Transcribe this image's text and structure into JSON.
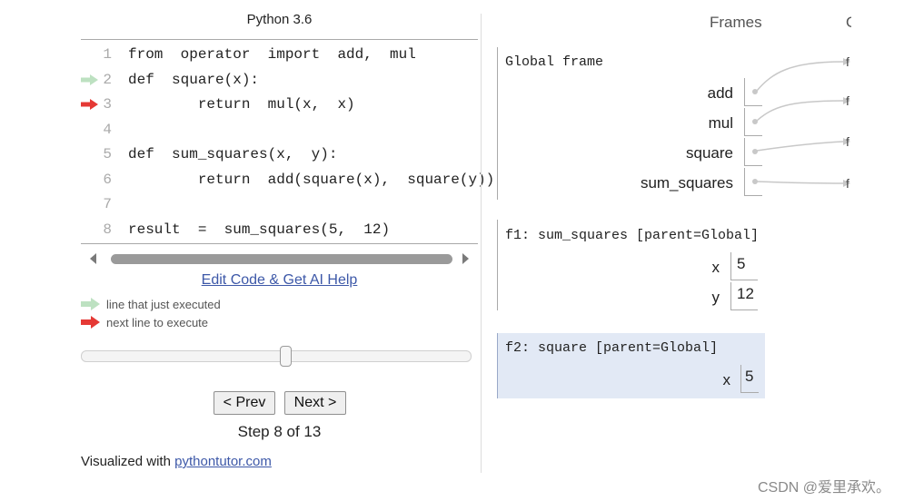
{
  "left_panel": {
    "language_title": "Python 3.6",
    "code_lines": [
      {
        "num": "1",
        "text": "from  operator  import  add,  mul",
        "arrow": ""
      },
      {
        "num": "2",
        "text": "def  square(x):",
        "arrow": "green"
      },
      {
        "num": "3",
        "text": "        return  mul(x,  x)",
        "arrow": "red"
      },
      {
        "num": "4",
        "text": "",
        "arrow": ""
      },
      {
        "num": "5",
        "text": "def  sum_squares(x,  y):",
        "arrow": ""
      },
      {
        "num": "6",
        "text": "        return  add(square(x),  square(y))",
        "arrow": ""
      },
      {
        "num": "7",
        "text": "",
        "arrow": ""
      },
      {
        "num": "8",
        "text": "result  =  sum_squares(5,  12)",
        "arrow": ""
      }
    ],
    "edit_link": "Edit Code & Get AI Help",
    "legend": [
      {
        "color": "green",
        "text": "line that just executed"
      },
      {
        "color": "red",
        "text": "next line to execute"
      }
    ],
    "slider": {
      "step": 8,
      "total": 13
    },
    "prev_label": "< Prev",
    "next_label": "Next >",
    "step_text": "Step 8 of 13",
    "footer_prefix": "Visualized with ",
    "footer_link": "pythontutor.com"
  },
  "right_panel": {
    "frames_title": "Frames",
    "objects_title": "Objects",
    "global_frame": {
      "title": "Global frame",
      "variables": [
        "add",
        "mul",
        "square",
        "sum_squares"
      ]
    },
    "f1": {
      "title": "f1: sum_squares [parent=Global]",
      "variables": [
        {
          "name": "x",
          "value": "5"
        },
        {
          "name": "y",
          "value": "12"
        }
      ]
    },
    "f2": {
      "title": "f2: square [parent=Global]",
      "variables": [
        {
          "name": "x",
          "value": "5"
        }
      ]
    },
    "object_glyphs": [
      "f",
      "f",
      "f",
      "f"
    ]
  },
  "watermark": "CSDN @爱里承欢。",
  "colors": {
    "green_arrow": "#bde1c1",
    "red_arrow": "#e53935",
    "link": "#3d58a8",
    "active_frame_bg": "#e2e9f5",
    "pointer": "#c8c8c8"
  }
}
